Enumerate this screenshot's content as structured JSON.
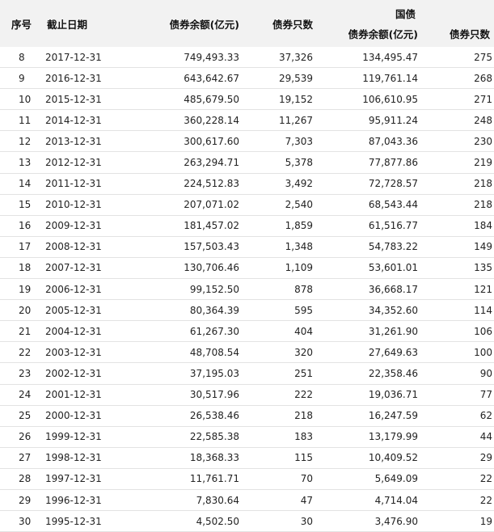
{
  "header": {
    "seq": "序号",
    "date": "截止日期",
    "balance": "债券余额(亿元)",
    "count": "债券只数",
    "gov_group": "国债",
    "gov_balance": "债券余额(亿元)",
    "gov_count": "债券只数"
  },
  "rows": [
    {
      "seq": "8",
      "date": "2017-12-31",
      "balance": "749,493.33",
      "count": "37,326",
      "gov_balance": "134,495.47",
      "gov_count": "275"
    },
    {
      "seq": "9",
      "date": "2016-12-31",
      "balance": "643,642.67",
      "count": "29,539",
      "gov_balance": "119,761.14",
      "gov_count": "268"
    },
    {
      "seq": "10",
      "date": "2015-12-31",
      "balance": "485,679.50",
      "count": "19,152",
      "gov_balance": "106,610.95",
      "gov_count": "271"
    },
    {
      "seq": "11",
      "date": "2014-12-31",
      "balance": "360,228.14",
      "count": "11,267",
      "gov_balance": "95,911.24",
      "gov_count": "248"
    },
    {
      "seq": "12",
      "date": "2013-12-31",
      "balance": "300,617.60",
      "count": "7,303",
      "gov_balance": "87,043.36",
      "gov_count": "230"
    },
    {
      "seq": "13",
      "date": "2012-12-31",
      "balance": "263,294.71",
      "count": "5,378",
      "gov_balance": "77,877.86",
      "gov_count": "219"
    },
    {
      "seq": "14",
      "date": "2011-12-31",
      "balance": "224,512.83",
      "count": "3,492",
      "gov_balance": "72,728.57",
      "gov_count": "218"
    },
    {
      "seq": "15",
      "date": "2010-12-31",
      "balance": "207,071.02",
      "count": "2,540",
      "gov_balance": "68,543.44",
      "gov_count": "218"
    },
    {
      "seq": "16",
      "date": "2009-12-31",
      "balance": "181,457.02",
      "count": "1,859",
      "gov_balance": "61,516.77",
      "gov_count": "184"
    },
    {
      "seq": "17",
      "date": "2008-12-31",
      "balance": "157,503.43",
      "count": "1,348",
      "gov_balance": "54,783.22",
      "gov_count": "149"
    },
    {
      "seq": "18",
      "date": "2007-12-31",
      "balance": "130,706.46",
      "count": "1,109",
      "gov_balance": "53,601.01",
      "gov_count": "135"
    },
    {
      "seq": "19",
      "date": "2006-12-31",
      "balance": "99,152.50",
      "count": "878",
      "gov_balance": "36,668.17",
      "gov_count": "121"
    },
    {
      "seq": "20",
      "date": "2005-12-31",
      "balance": "80,364.39",
      "count": "595",
      "gov_balance": "34,352.60",
      "gov_count": "114"
    },
    {
      "seq": "21",
      "date": "2004-12-31",
      "balance": "61,267.30",
      "count": "404",
      "gov_balance": "31,261.90",
      "gov_count": "106"
    },
    {
      "seq": "22",
      "date": "2003-12-31",
      "balance": "48,708.54",
      "count": "320",
      "gov_balance": "27,649.63",
      "gov_count": "100"
    },
    {
      "seq": "23",
      "date": "2002-12-31",
      "balance": "37,195.03",
      "count": "251",
      "gov_balance": "22,358.46",
      "gov_count": "90"
    },
    {
      "seq": "24",
      "date": "2001-12-31",
      "balance": "30,517.96",
      "count": "222",
      "gov_balance": "19,036.71",
      "gov_count": "77"
    },
    {
      "seq": "25",
      "date": "2000-12-31",
      "balance": "26,538.46",
      "count": "218",
      "gov_balance": "16,247.59",
      "gov_count": "62"
    },
    {
      "seq": "26",
      "date": "1999-12-31",
      "balance": "22,585.38",
      "count": "183",
      "gov_balance": "13,179.99",
      "gov_count": "44"
    },
    {
      "seq": "27",
      "date": "1998-12-31",
      "balance": "18,368.33",
      "count": "115",
      "gov_balance": "10,409.52",
      "gov_count": "29"
    },
    {
      "seq": "28",
      "date": "1997-12-31",
      "balance": "11,761.71",
      "count": "70",
      "gov_balance": "5,649.09",
      "gov_count": "22"
    },
    {
      "seq": "29",
      "date": "1996-12-31",
      "balance": "7,830.64",
      "count": "47",
      "gov_balance": "4,714.04",
      "gov_count": "22"
    },
    {
      "seq": "30",
      "date": "1995-12-31",
      "balance": "4,502.50",
      "count": "30",
      "gov_balance": "3,476.90",
      "gov_count": "19"
    }
  ]
}
